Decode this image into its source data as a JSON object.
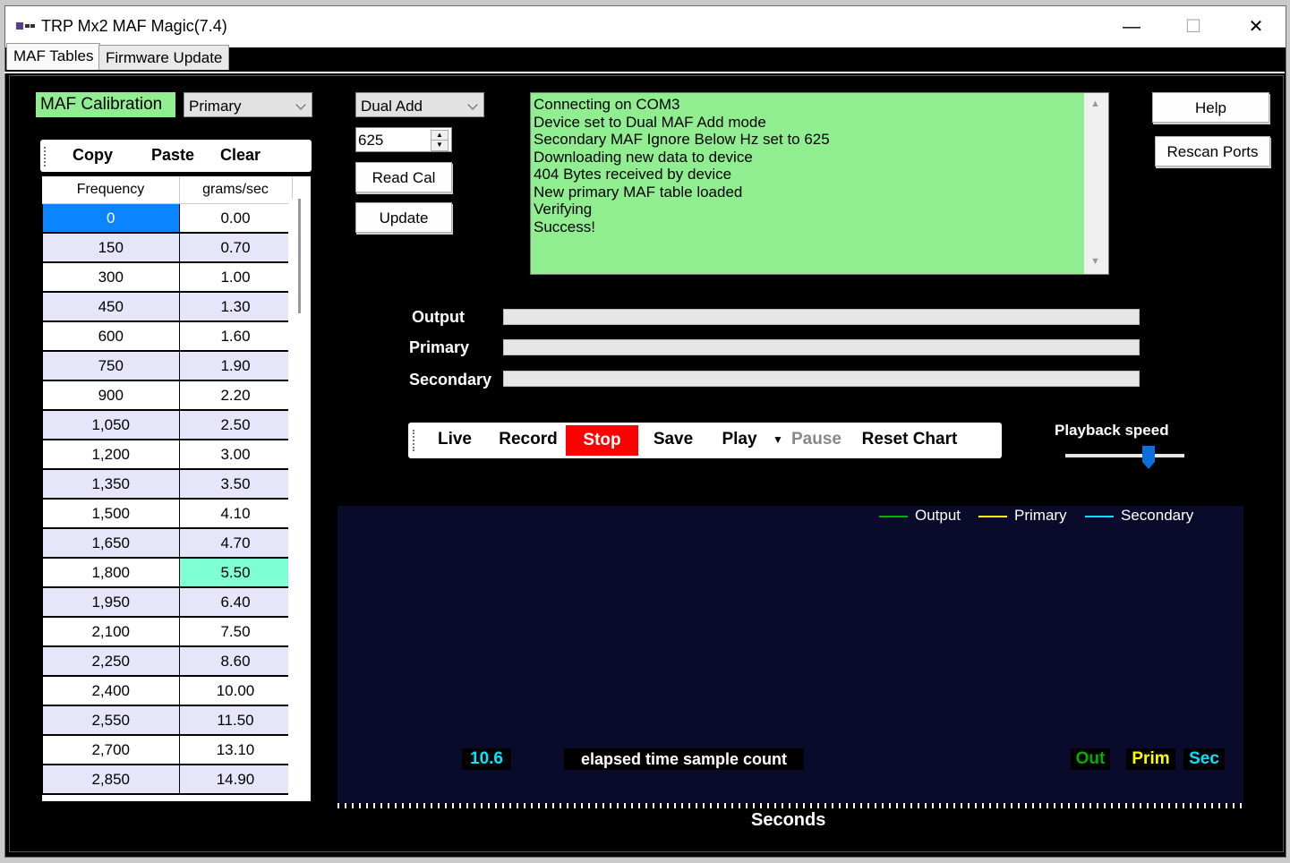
{
  "window": {
    "title": "TRP Mx2 MAF Magic(7.4)",
    "minimize": "—",
    "maximize": "☐",
    "close": "✕"
  },
  "tabs": [
    {
      "label": "MAF Tables",
      "active": true
    },
    {
      "label": "Firmware Update",
      "active": false
    }
  ],
  "calibration": {
    "label": "MAF Calibration",
    "table_select": "Primary",
    "toolbar": {
      "copy": "Copy",
      "paste": "Paste",
      "clear": "Clear"
    },
    "columns": [
      "Frequency",
      "grams/sec"
    ],
    "rows": [
      {
        "freq": "0",
        "gps": "0.00"
      },
      {
        "freq": "150",
        "gps": "0.70"
      },
      {
        "freq": "300",
        "gps": "1.00"
      },
      {
        "freq": "450",
        "gps": "1.30"
      },
      {
        "freq": "600",
        "gps": "1.60"
      },
      {
        "freq": "750",
        "gps": "1.90"
      },
      {
        "freq": "900",
        "gps": "2.20"
      },
      {
        "freq": "1,050",
        "gps": "2.50"
      },
      {
        "freq": "1,200",
        "gps": "3.00"
      },
      {
        "freq": "1,350",
        "gps": "3.50"
      },
      {
        "freq": "1,500",
        "gps": "4.10"
      },
      {
        "freq": "1,650",
        "gps": "4.70"
      },
      {
        "freq": "1,800",
        "gps": "5.50"
      },
      {
        "freq": "1,950",
        "gps": "6.40"
      },
      {
        "freq": "2,100",
        "gps": "7.50"
      },
      {
        "freq": "2,250",
        "gps": "8.60"
      },
      {
        "freq": "2,400",
        "gps": "10.00"
      },
      {
        "freq": "2,550",
        "gps": "11.50"
      },
      {
        "freq": "2,700",
        "gps": "13.10"
      },
      {
        "freq": "2,850",
        "gps": "14.90"
      }
    ]
  },
  "device": {
    "mode_select": "Dual Add",
    "ignore_hz_value": "625",
    "read_cal": "Read Cal",
    "update": "Update"
  },
  "log": {
    "lines": [
      "Connecting on COM3",
      "Device set to Dual MAF Add mode",
      "Secondary MAF Ignore Below Hz set to 625",
      "Downloading new data to device",
      "404 Bytes received by device",
      "New primary MAF table loaded",
      "Verifying",
      "Success!"
    ]
  },
  "side_buttons": {
    "help": "Help",
    "rescan": "Rescan Ports"
  },
  "meters": {
    "output": "Output",
    "primary": "Primary",
    "secondary": "Secondary"
  },
  "playback_toolbar": {
    "live": "Live",
    "record": "Record",
    "stop": "Stop",
    "save": "Save",
    "play": "Play",
    "pause": "Pause",
    "reset_chart": "Reset Chart"
  },
  "playback_speed": {
    "label": "Playback speed",
    "value": 0.7
  },
  "chart": {
    "legend": [
      {
        "name": "Output",
        "color": "#00b000"
      },
      {
        "name": "Primary",
        "color": "#ffff00"
      },
      {
        "name": "Secondary",
        "color": "#00e5ff"
      }
    ],
    "elapsed_value": "10.6",
    "elapsed_label": "elapsed time sample count",
    "tag_out": "Out",
    "tag_prim": "Prim",
    "tag_sec": "Sec",
    "xlabel": "Seconds"
  },
  "colors": {
    "log_bg": "#90ee90",
    "stop_bg": "#ff0000",
    "chart_bg": "#0a0a2a",
    "selected_cell": "#0a84ff",
    "highlight_cell": "#7fffd4",
    "alt_row": "#e6e6fa"
  }
}
